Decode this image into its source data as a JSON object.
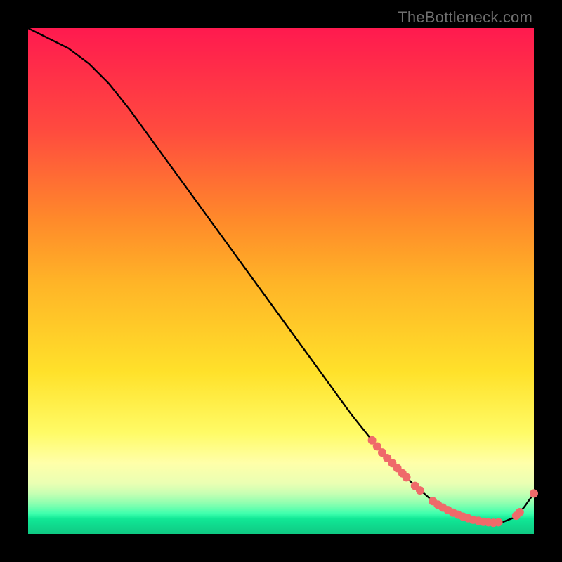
{
  "watermark": "TheBottleneck.com",
  "chart_data": {
    "type": "line",
    "title": "",
    "xlabel": "",
    "ylabel": "",
    "xlim": [
      0,
      100
    ],
    "ylim": [
      0,
      100
    ],
    "grid": false,
    "legend": false,
    "series": [
      {
        "name": "bottleneck-curve",
        "color": "#000000",
        "x": [
          0,
          4,
          8,
          12,
          16,
          20,
          24,
          28,
          32,
          36,
          40,
          44,
          48,
          52,
          56,
          60,
          64,
          68,
          72,
          76,
          80,
          82,
          84,
          86,
          88,
          90,
          92,
          94,
          96,
          98,
          100
        ],
        "y": [
          100,
          98,
          96,
          93,
          89,
          84,
          78.5,
          73,
          67.5,
          62,
          56.5,
          51,
          45.5,
          40,
          34.5,
          29,
          23.5,
          18.5,
          14,
          10,
          6.5,
          5.2,
          4.2,
          3.4,
          2.8,
          2.4,
          2.2,
          2.4,
          3.2,
          5.2,
          8
        ]
      }
    ],
    "markers": [
      {
        "name": "highlight-dots",
        "color": "#ef6a6a",
        "radius_px": 6,
        "points": [
          {
            "x": 68.0,
            "y": 18.5
          },
          {
            "x": 69.0,
            "y": 17.3
          },
          {
            "x": 70.0,
            "y": 16.1
          },
          {
            "x": 71.0,
            "y": 15.0
          },
          {
            "x": 72.0,
            "y": 14.0
          },
          {
            "x": 73.0,
            "y": 13.0
          },
          {
            "x": 74.0,
            "y": 12.0
          },
          {
            "x": 74.8,
            "y": 11.2
          },
          {
            "x": 76.5,
            "y": 9.5
          },
          {
            "x": 77.5,
            "y": 8.6
          },
          {
            "x": 80.0,
            "y": 6.5
          },
          {
            "x": 81.0,
            "y": 5.8
          },
          {
            "x": 82.0,
            "y": 5.2
          },
          {
            "x": 83.0,
            "y": 4.7
          },
          {
            "x": 84.0,
            "y": 4.2
          },
          {
            "x": 85.0,
            "y": 3.8
          },
          {
            "x": 86.0,
            "y": 3.4
          },
          {
            "x": 87.0,
            "y": 3.1
          },
          {
            "x": 88.0,
            "y": 2.8
          },
          {
            "x": 89.0,
            "y": 2.6
          },
          {
            "x": 90.0,
            "y": 2.4
          },
          {
            "x": 91.0,
            "y": 2.3
          },
          {
            "x": 92.0,
            "y": 2.2
          },
          {
            "x": 93.0,
            "y": 2.3
          },
          {
            "x": 96.5,
            "y": 3.6
          },
          {
            "x": 97.2,
            "y": 4.3
          },
          {
            "x": 100.0,
            "y": 8.0
          }
        ]
      }
    ],
    "background_gradient": {
      "direction": "vertical",
      "stops": [
        {
          "pos": 0.0,
          "color": "#ff1a4f"
        },
        {
          "pos": 0.2,
          "color": "#ff4a3f"
        },
        {
          "pos": 0.38,
          "color": "#ff8a2a"
        },
        {
          "pos": 0.5,
          "color": "#ffb327"
        },
        {
          "pos": 0.68,
          "color": "#ffe12a"
        },
        {
          "pos": 0.8,
          "color": "#fffb66"
        },
        {
          "pos": 0.86,
          "color": "#ffffa9"
        },
        {
          "pos": 0.9,
          "color": "#eaffb3"
        },
        {
          "pos": 0.94,
          "color": "#8cffb0"
        },
        {
          "pos": 0.97,
          "color": "#11e896"
        },
        {
          "pos": 1.0,
          "color": "#0fc983"
        }
      ]
    }
  }
}
